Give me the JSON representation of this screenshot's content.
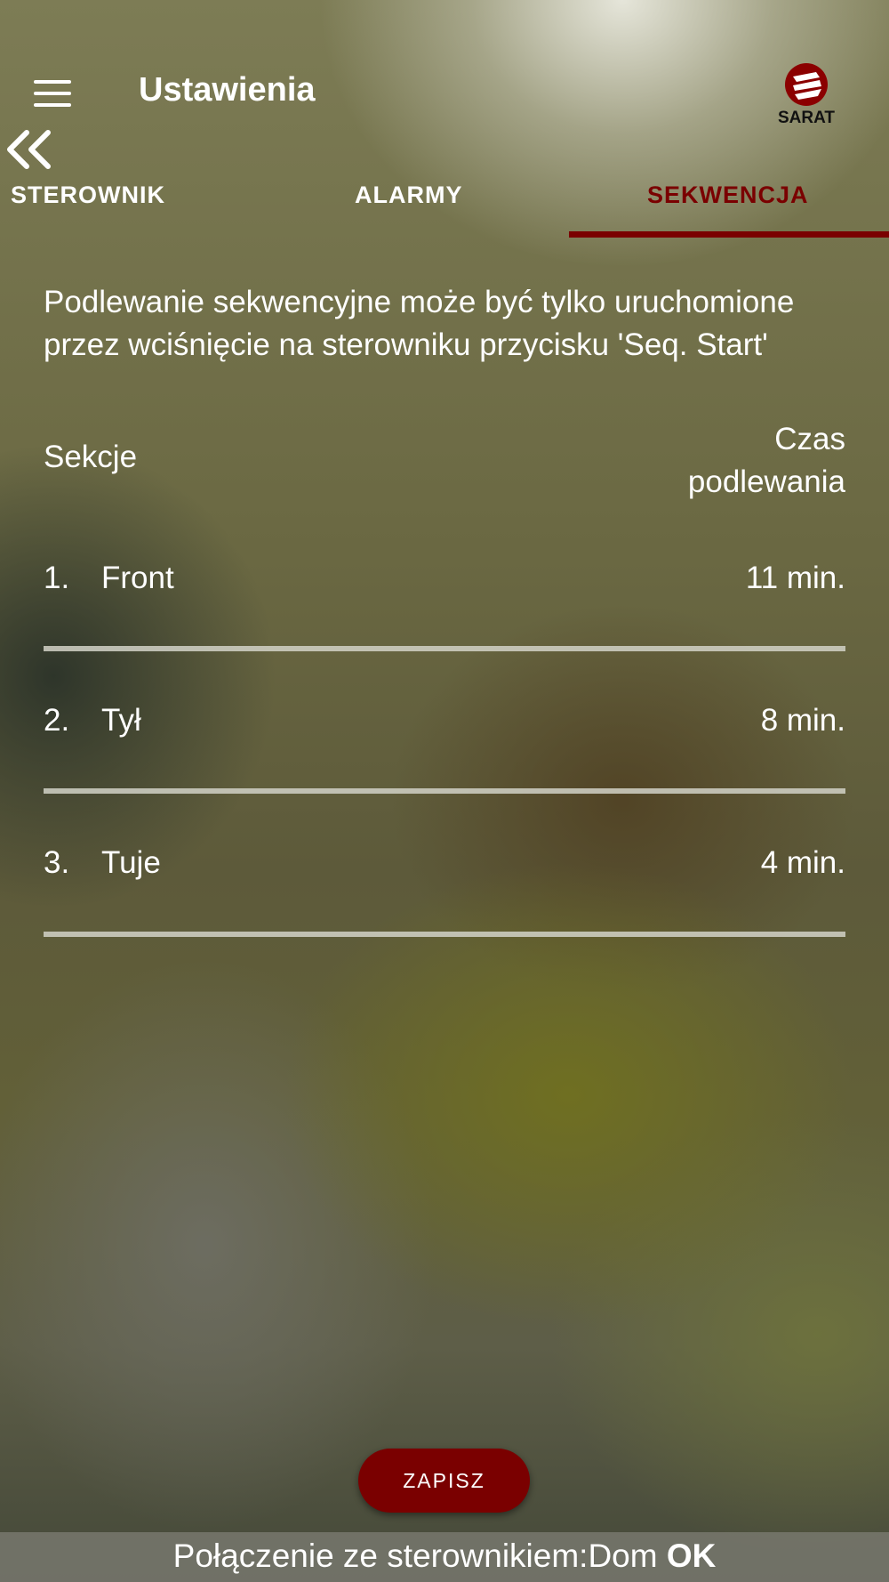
{
  "header": {
    "title": "Ustawienia",
    "logo_text": "SARAT"
  },
  "tabs": [
    {
      "label": "STEROWNIK"
    },
    {
      "label": "ALARMY"
    },
    {
      "label": "SEKWENCJA"
    }
  ],
  "active_tab": 2,
  "info_text": "Podlewanie sekwencyjne może być tylko uruchomione przez wciśnięcie na sterowniku przycisku 'Seq. Start'",
  "columns": {
    "left": "Sekcje",
    "right_line1": "Czas",
    "right_line2": "podlewania"
  },
  "sections": [
    {
      "num": "1.",
      "name": "Front",
      "time": "11 min."
    },
    {
      "num": "2.",
      "name": "Tył",
      "time": "8 min."
    },
    {
      "num": "3.",
      "name": "Tuje",
      "time": "4 min."
    }
  ],
  "save_label": "ZAPISZ",
  "status": {
    "prefix": "Połączenie ze sterownikiem:Dom ",
    "state": "OK"
  },
  "colors": {
    "accent": "#7a0000",
    "text": "#ffffff"
  },
  "icons": [
    "hamburger-menu-icon",
    "double-chevron-left-icon",
    "sarat-logo"
  ]
}
